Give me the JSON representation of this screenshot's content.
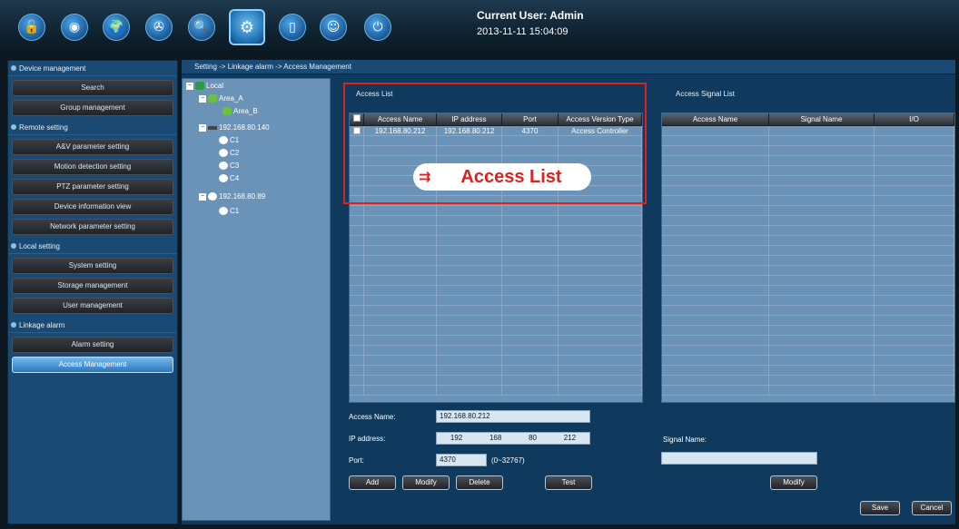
{
  "header": {
    "user_label": "Current User: Admin",
    "datetime": "2013-11-11 15:04:09",
    "toolbar_icons": [
      "unlock-icon",
      "webcam-icon",
      "world-map-icon",
      "reel-icon",
      "search-log-icon",
      "settings-icon",
      "door-icon",
      "face-icon",
      "power-icon"
    ]
  },
  "sidebar": {
    "sections": [
      {
        "title": "Device management",
        "items": [
          "Search",
          "Group management"
        ]
      },
      {
        "title": "Remote setting",
        "items": [
          "A&V parameter setting",
          "Motion detection setting",
          "PTZ parameter setting",
          "Device information view",
          "Network parameter setting"
        ]
      },
      {
        "title": "Local setting",
        "items": [
          "System setting",
          "Storage management",
          "User management"
        ]
      },
      {
        "title": "Linkage alarm",
        "items": [
          "Alarm setting",
          "Access Management"
        ]
      }
    ],
    "active_item": "Access Management"
  },
  "breadcrumb": "Setting -> Linkage alarm -> Access Management",
  "tree": {
    "root": "Local",
    "area_a": "Area_A",
    "area_b": "Area_B",
    "dev1": "192.168.80.140",
    "dev1_channels": [
      "C1",
      "C2",
      "C3",
      "C4"
    ],
    "dev2": "192.168.80.89",
    "dev2_channels": [
      "C1"
    ]
  },
  "access_list": {
    "title": "Access List",
    "columns": [
      "Access Name",
      "IP address",
      "Port",
      "Access Version Type"
    ],
    "rows": [
      [
        "192.168.80.212",
        "192.168.80.212",
        "4370",
        "Access Controller"
      ]
    ]
  },
  "signal_list": {
    "title": "Access Signal List",
    "columns": [
      "Access Name",
      "Signal Name",
      "I/O"
    ]
  },
  "annotation": {
    "label": "Access List",
    "arrow": "⇉"
  },
  "form": {
    "access_name_label": "Access Name:",
    "access_name_value": "192.168.80.212",
    "ip_label": "IP address:",
    "ip_octets": [
      "192",
      "168",
      "80",
      "212"
    ],
    "port_label": "Port:",
    "port_value": "4370",
    "port_range": "(0~32767)",
    "signal_name_label": "Signal Name:",
    "signal_name_value": ""
  },
  "buttons": {
    "add": "Add",
    "modify": "Modify",
    "delete": "Delete",
    "test": "Test",
    "signal_modify": "Modify",
    "save": "Save",
    "cancel": "Cancel"
  }
}
